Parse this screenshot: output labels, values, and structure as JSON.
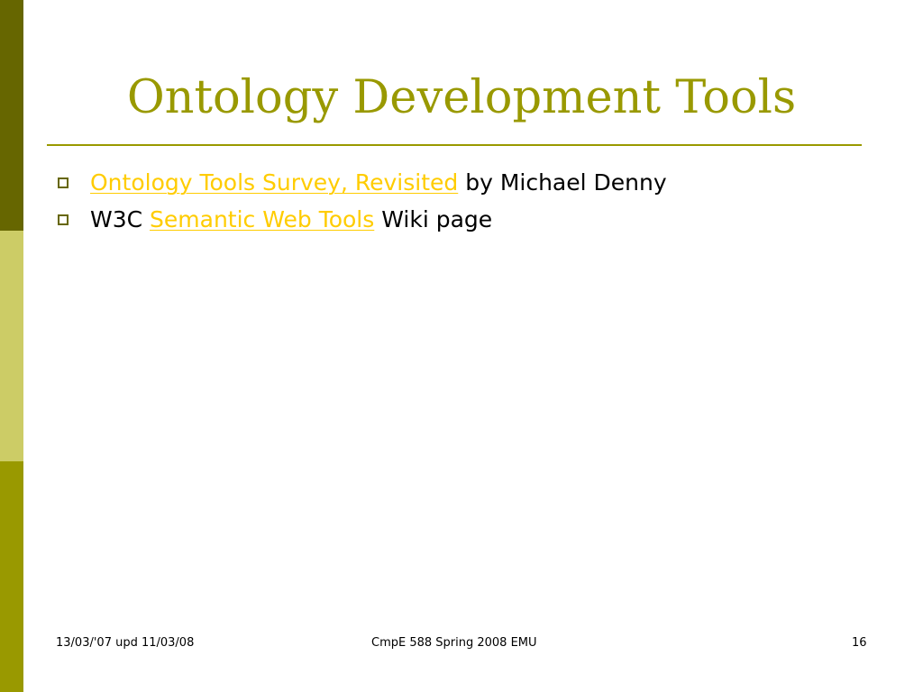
{
  "colors": {
    "sidebar_dark": "#666600",
    "sidebar_light": "#cccc66",
    "sidebar_mid": "#999900",
    "title": "#999900",
    "rule": "#999900",
    "bullet": "#666600",
    "link": "#ffcc00"
  },
  "slide": {
    "title": "Ontology Development Tools",
    "bullets": [
      {
        "link_text": "Ontology Tools Survey, Revisited",
        "after_text": " by Michael Denny"
      },
      {
        "before_text": "W3C ",
        "link_text": "Semantic Web Tools",
        "after_text": " Wiki page"
      }
    ]
  },
  "footer": {
    "left": "13/03/'07 upd 11/03/08",
    "center": "CmpE 588 Spring 2008 EMU",
    "right": "16"
  }
}
